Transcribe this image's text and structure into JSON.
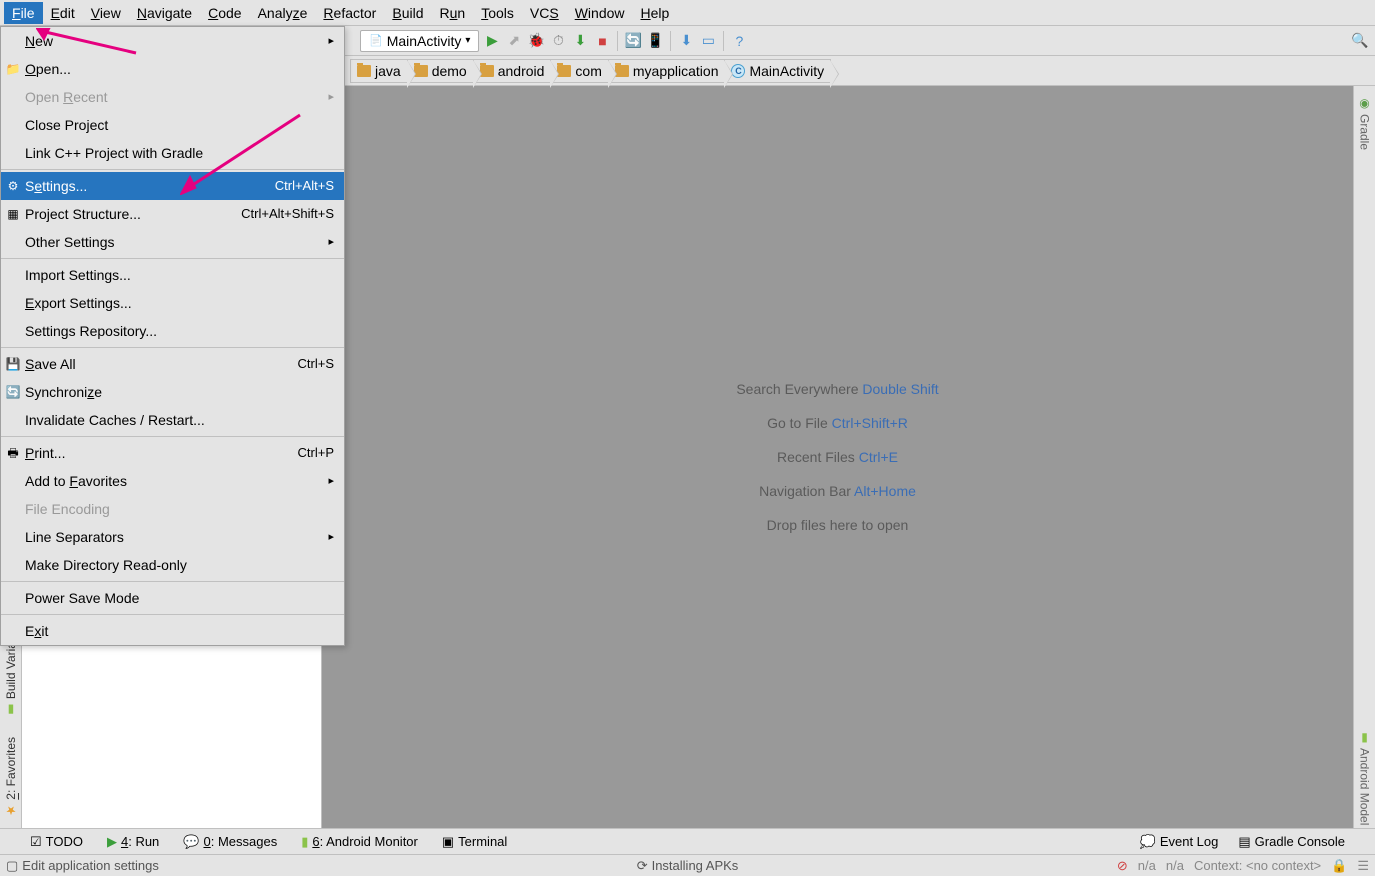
{
  "menubar": [
    "File",
    "Edit",
    "View",
    "Navigate",
    "Code",
    "Analyze",
    "Refactor",
    "Build",
    "Run",
    "Tools",
    "VCS",
    "Window",
    "Help"
  ],
  "toolbar": {
    "config": "MainActivity"
  },
  "breadcrumbs": [
    "java",
    "demo",
    "android",
    "com",
    "myapplication",
    "MainActivity"
  ],
  "dropdown": {
    "items": [
      {
        "label": "New",
        "submenu": true
      },
      {
        "icon": "folder",
        "label": "Open..."
      },
      {
        "label": "Open Recent",
        "disabled": true,
        "submenu": true
      },
      {
        "label": "Close Project"
      },
      {
        "label": "Link C++ Project with Gradle"
      },
      {
        "sep": true
      },
      {
        "icon": "gear",
        "label": "Settings...",
        "shortcut": "Ctrl+Alt+S",
        "hl": true
      },
      {
        "icon": "struct",
        "label": "Project Structure...",
        "shortcut": "Ctrl+Alt+Shift+S"
      },
      {
        "label": "Other Settings",
        "submenu": true
      },
      {
        "sep": true
      },
      {
        "label": "Import Settings..."
      },
      {
        "label": "Export Settings..."
      },
      {
        "label": "Settings Repository..."
      },
      {
        "sep": true
      },
      {
        "icon": "save",
        "label": "Save All",
        "shortcut": "Ctrl+S"
      },
      {
        "icon": "sync",
        "label": "Synchronize"
      },
      {
        "label": "Invalidate Caches / Restart..."
      },
      {
        "sep": true
      },
      {
        "icon": "print",
        "label": "Print...",
        "shortcut": "Ctrl+P"
      },
      {
        "label": "Add to Favorites",
        "submenu": true
      },
      {
        "label": "File Encoding",
        "disabled": true
      },
      {
        "label": "Line Separators",
        "submenu": true
      },
      {
        "label": "Make Directory Read-only"
      },
      {
        "sep": true
      },
      {
        "label": "Power Save Mode"
      },
      {
        "sep": true
      },
      {
        "label": "Exit"
      }
    ]
  },
  "hints": [
    {
      "text": "Search Everywhere",
      "key": "Double Shift"
    },
    {
      "text": "Go to File",
      "key": "Ctrl+Shift+R"
    },
    {
      "text": "Recent Files",
      "key": "Ctrl+E"
    },
    {
      "text": "Navigation Bar",
      "key": "Alt+Home"
    },
    {
      "text": "Drop files here to open",
      "key": ""
    }
  ],
  "left_strip": {
    "build": "Build Variants",
    "fav": "2: Favorites"
  },
  "right_strip": {
    "gradle": "Gradle",
    "model": "Android Model"
  },
  "bottom_tabs": {
    "todo": "TODO",
    "run": "4: Run",
    "messages": "0: Messages",
    "monitor": "6: Android Monitor",
    "terminal": "Terminal",
    "eventlog": "Event Log",
    "gradlec": "Gradle Console"
  },
  "statusbar": {
    "left": "Edit application settings",
    "center": "Installing APKs",
    "na": "n/a",
    "context": "Context: <no context>"
  }
}
